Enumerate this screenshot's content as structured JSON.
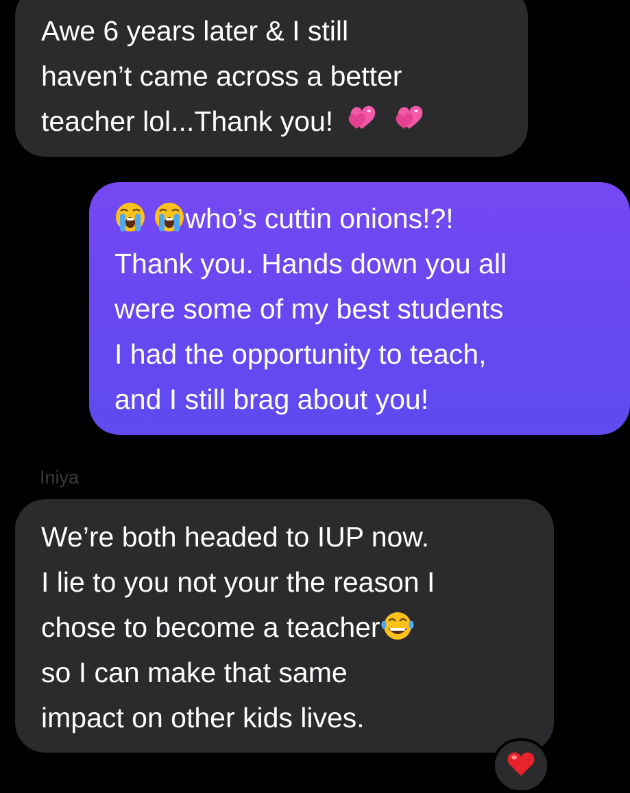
{
  "conversation": {
    "messages": [
      {
        "direction": "incoming",
        "lines": [
          "Awe 6 years later & I still",
          "haven’t came across a better",
          "teacher lol...Thank you!"
        ],
        "trailing_emojis": [
          "revolving-hearts",
          "revolving-hearts"
        ]
      },
      {
        "direction": "outgoing",
        "leading_emojis": [
          "loudly-crying-face",
          "loudly-crying-face"
        ],
        "lines": [
          "who’s cuttin onions!?!",
          "Thank you. Hands down you all",
          "were some of my best students",
          "I had the opportunity to teach,",
          "and I still brag about you!"
        ]
      },
      {
        "direction": "incoming",
        "sender": "Iniya",
        "lines": [
          "We’re both headed to IUP now.",
          "I lie to you not your the reason I",
          "chose to become a teacher",
          "so I can make that same",
          "impact on other kids lives."
        ],
        "inline_emoji": "face-with-tears-of-joy",
        "reaction": "red-heart"
      }
    ]
  },
  "colors": {
    "background": "#000000",
    "incoming_bubble": "#2b2b2d",
    "outgoing_bubble": "#6a48f1",
    "text": "#ffffff",
    "sender_name": "#3b3b3d"
  }
}
